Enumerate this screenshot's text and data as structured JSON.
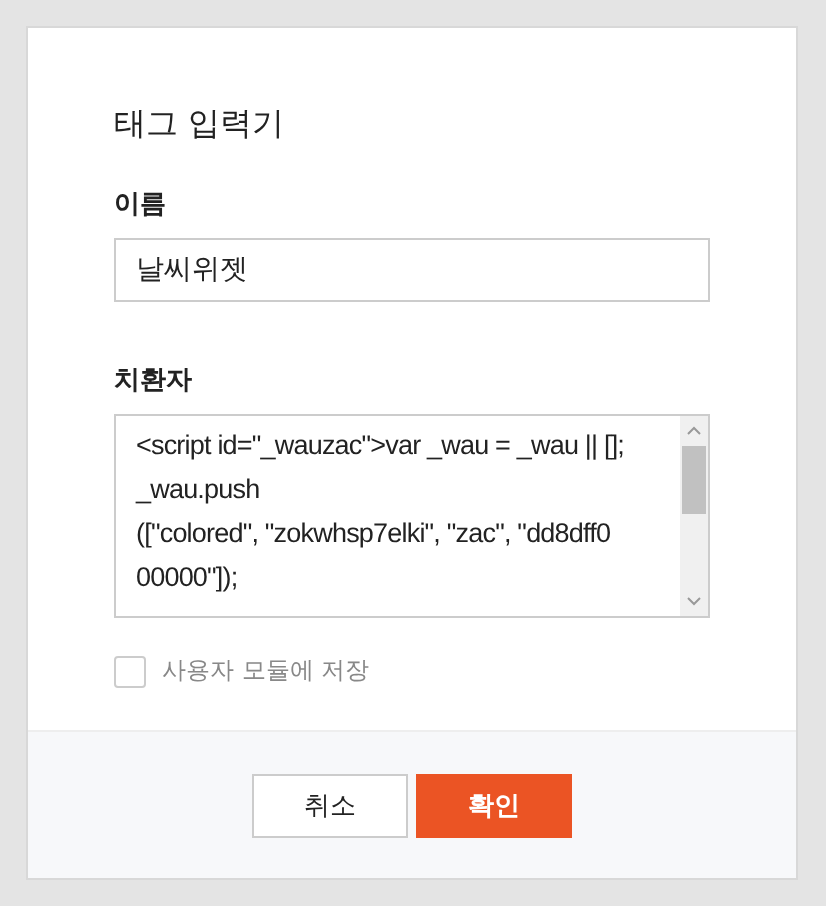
{
  "dialog": {
    "title": "태그 입력기"
  },
  "name_field": {
    "label": "이름",
    "value": "날씨위젯"
  },
  "replacement_field": {
    "label": "치환자",
    "value": "<script id=\"_wauzac\">var _wau = _wau || [];\n_wau.push\n([\"colored\", \"zokwhsp7elki\", \"zac\", \"dd8dff0\n00000\"]);"
  },
  "save_option": {
    "label": "사용자 모듈에 저장",
    "checked": false
  },
  "buttons": [
    {
      "label": "취소",
      "kind": "secondary"
    },
    {
      "label": "확인",
      "kind": "primary"
    }
  ]
}
